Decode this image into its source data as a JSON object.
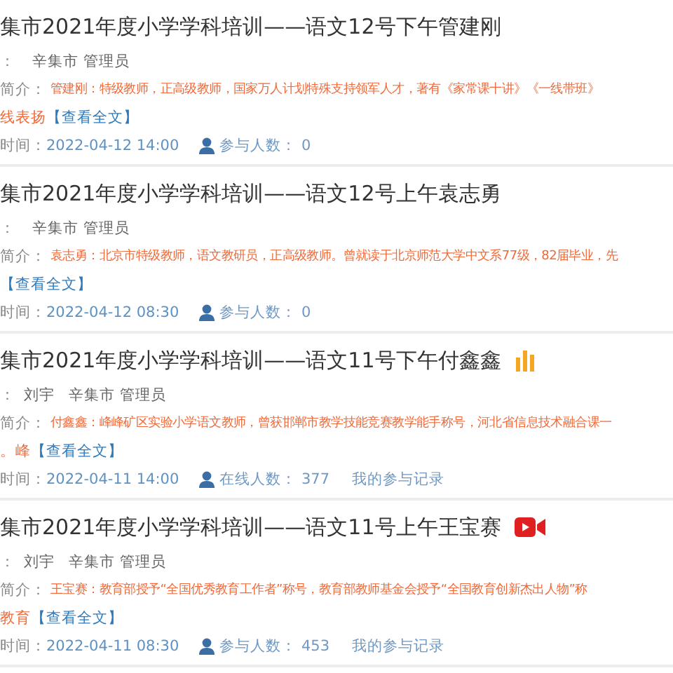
{
  "courses": [
    {
      "title": "集市2021年度小学学科培训——语文12号下午管建刚",
      "teacher_label": "：",
      "org": "辛集市 管理员",
      "intro_label": "简介：",
      "intro": "管建刚：特级教师，正高级教师，国家万人计划特殊支持领军人才，著有《家常课十讲》《一线带班》",
      "intro_tail": "线表扬",
      "more_link": "【查看全文】",
      "time_label": "时间：",
      "time": "2022-04-12 14:00",
      "count_label": "参与人数：",
      "count": "0"
    },
    {
      "title": "集市2021年度小学学科培训——语文12号上午袁志勇",
      "teacher_label": "：",
      "org": "辛集市 管理员",
      "intro_label": "简介：",
      "intro": "袁志勇：北京市特级教师，语文教研员，正高级教师。曾就读于北京师范大学中文系77级，82届毕业，先",
      "more_link": "【查看全文】",
      "time_label": "时间：",
      "time": "2022-04-12 08:30",
      "count_label": "参与人数：",
      "count": "0"
    },
    {
      "title": "集市2021年度小学学科培训——语文11号下午付鑫鑫",
      "kind": "live",
      "teacher_label": "：",
      "teacher": "刘宇",
      "org": "辛集市 管理员",
      "intro_label": "简介：",
      "intro": "付鑫鑫：峰峰矿区实验小学语文教师，曾获邯郸市教学技能竞赛教学能手称号，河北省信息技术融合课一",
      "intro_tail": "。峰",
      "more_link": "【查看全文】",
      "time_label": "时间：",
      "time": "2022-04-11 14:00",
      "count_label": "在线人数：",
      "count": "377",
      "record_link": "我的参与记录"
    },
    {
      "title": "集市2021年度小学学科培训——语文11号上午王宝赛",
      "kind": "video",
      "teacher_label": "：",
      "teacher": "刘宇",
      "org": "辛集市 管理员",
      "intro_label": "简介：",
      "intro": "王宝赛：教育部授予“全国优秀教育工作者”称号，教育部教师基金会授予“全国教育创新杰出人物”称",
      "intro_tail": "教育",
      "more_link": "【查看全文】",
      "time_label": "时间：",
      "time": "2022-04-11 08:30",
      "count_label": "参与人数：",
      "count": "453",
      "record_link": "我的参与记录"
    }
  ]
}
